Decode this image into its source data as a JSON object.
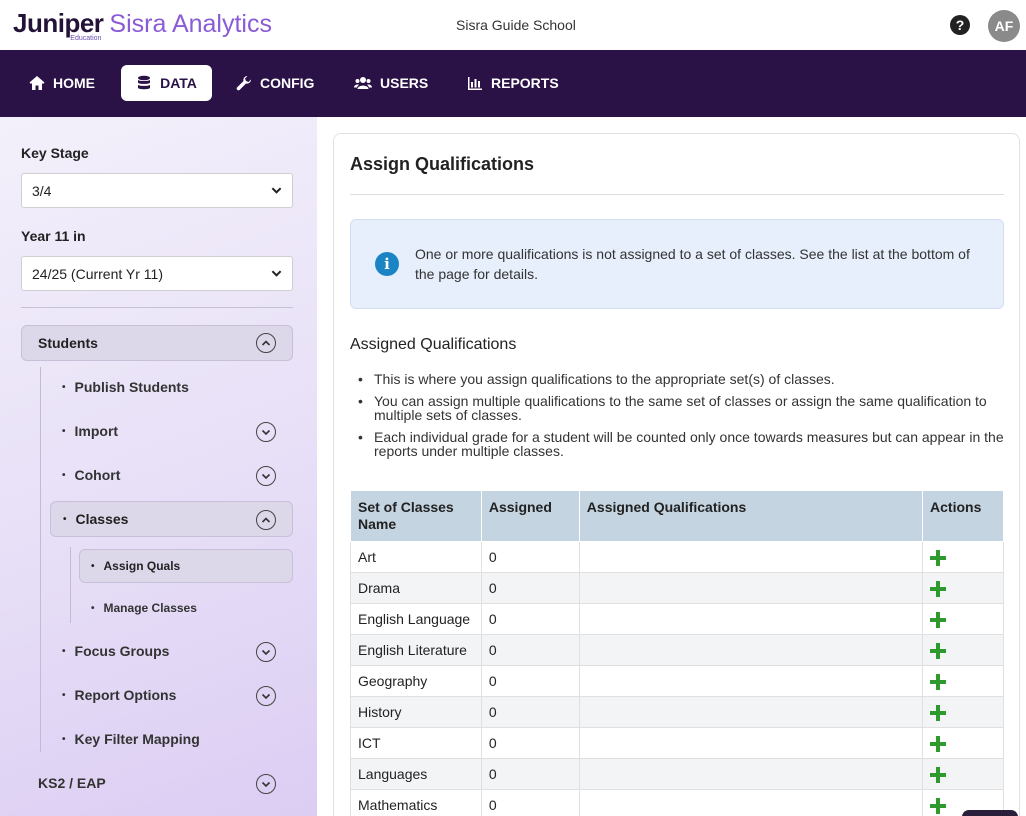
{
  "brand": {
    "juniper": "Juniper",
    "education": "Education",
    "product": "Sisra Analytics"
  },
  "header": {
    "school": "Sisra Guide School",
    "help_glyph": "?",
    "avatar_initials": "AF"
  },
  "nav": {
    "items": [
      {
        "label": "HOME",
        "icon": "home-icon",
        "active": false
      },
      {
        "label": "DATA",
        "icon": "database-icon",
        "active": true
      },
      {
        "label": "CONFIG",
        "icon": "wrench-icon",
        "active": false
      },
      {
        "label": "USERS",
        "icon": "users-icon",
        "active": false
      },
      {
        "label": "REPORTS",
        "icon": "bar-chart-icon",
        "active": false
      }
    ]
  },
  "sidebar": {
    "key_stage_label": "Key Stage",
    "key_stage_value": "3/4",
    "year_label": "Year 11 in",
    "year_value": "24/25 (Current Yr 11)",
    "students_label": "Students",
    "publish_students": "Publish Students",
    "import": "Import",
    "cohort": "Cohort",
    "classes": "Classes",
    "assign_quals": "Assign Quals",
    "manage_classes": "Manage Classes",
    "focus_groups": "Focus Groups",
    "report_options": "Report Options",
    "key_filter_mapping": "Key Filter Mapping",
    "ks2_eap": "KS2 / EAP"
  },
  "main": {
    "title": "Assign Qualifications",
    "alert_text": "One or more qualifications is not assigned to a set of classes. See the list at the bottom of the page for details.",
    "alert_icon": "i",
    "section_title": "Assigned Qualifications",
    "bullets": [
      "This is where you assign qualifications to the appropriate set(s) of classes.",
      "You can assign multiple qualifications to the same set of classes or assign the same qualification to multiple sets of classes.",
      "Each individual grade for a student will be counted only once towards measures but can appear in the reports under multiple classes."
    ],
    "table": {
      "headers": [
        "Set of Classes Name",
        "Assigned",
        "Assigned Qualifications",
        "Actions"
      ],
      "rows": [
        {
          "name": "Art",
          "assigned": "0",
          "quals": ""
        },
        {
          "name": "Drama",
          "assigned": "0",
          "quals": ""
        },
        {
          "name": "English Language",
          "assigned": "0",
          "quals": ""
        },
        {
          "name": "English Literature",
          "assigned": "0",
          "quals": ""
        },
        {
          "name": "Geography",
          "assigned": "0",
          "quals": ""
        },
        {
          "name": "History",
          "assigned": "0",
          "quals": ""
        },
        {
          "name": "ICT",
          "assigned": "0",
          "quals": ""
        },
        {
          "name": "Languages",
          "assigned": "0",
          "quals": ""
        },
        {
          "name": "Mathematics",
          "assigned": "0",
          "quals": ""
        }
      ]
    }
  },
  "colors": {
    "nav_bg": "#2a1247",
    "brand_purple": "#8a5bd6",
    "add_green": "#2e9a2e",
    "table_header": "#c4d4e1",
    "alert_bg": "#e6effb"
  }
}
